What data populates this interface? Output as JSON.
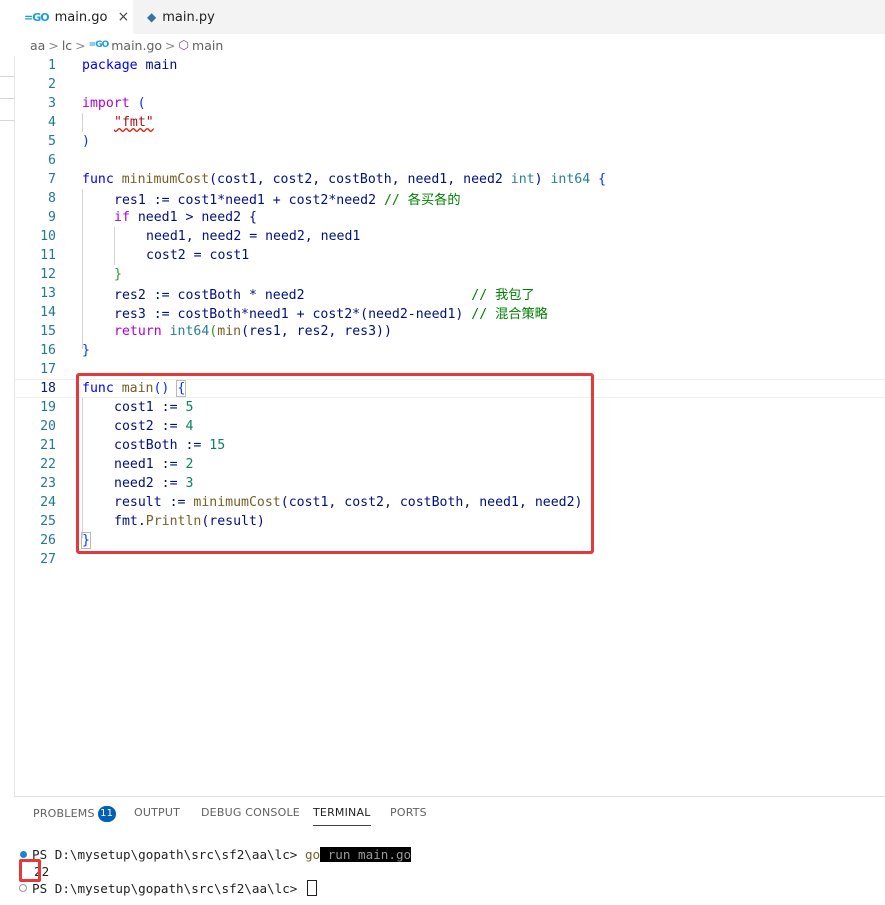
{
  "tabs": [
    {
      "name": "main.go",
      "close": "×",
      "active": true
    },
    {
      "name": "main.py",
      "active": false
    }
  ],
  "breadcrumb": {
    "parts": [
      "aa",
      "lc",
      "main.go",
      "main"
    ],
    "sep": ">"
  },
  "editor": {
    "line_numbers": [
      "1",
      "2",
      "3",
      "4",
      "5",
      "6",
      "7",
      "8",
      "9",
      "10",
      "11",
      "12",
      "13",
      "14",
      "15",
      "16",
      "17",
      "18",
      "19",
      "20",
      "21",
      "22",
      "23",
      "24",
      "25",
      "26",
      "27"
    ],
    "code": {
      "l1_kw": "package",
      "l1_rest": " main",
      "l3_kw": "import",
      "l3_rest": " (",
      "l4_str": "\"fmt\"",
      "l5": ")",
      "l7_kw": "func",
      "l7_fn": "minimumCost",
      "l7_a": "(cost1, cost2, costBoth, need1, need2 ",
      "l7_t1": "int",
      "l7_b": ") ",
      "l7_t2": "int64",
      "l7_c": " {",
      "l8_code": "res1 := cost1*need1 + cost2*need2 ",
      "l8_cm": "// 各买各的",
      "l9_kw": "if",
      "l9_rest": " need1 > need2 {",
      "l10": "need1, need2 = need2, need1",
      "l11": "cost2 = cost1",
      "l12": "}",
      "l13_code": "res2 := costBoth * need2                     ",
      "l13_cm": "// 我包了",
      "l14_code": "res3 := costBoth*need1 + cost2*(need2-need1) ",
      "l14_cm": "// 混合策略",
      "l15_kw": "return",
      "l15_t": "int64",
      "l15_a": "(",
      "l15_fn": "min",
      "l15_b": "(res1, res2, res3))",
      "l16": "}",
      "l18_kw": "func",
      "l18_fn": "main",
      "l18_a": "() ",
      "l18_b": "{",
      "l19_a": "cost1 := ",
      "l19_n": "5",
      "l20_a": "cost2 := ",
      "l20_n": "4",
      "l21_a": "costBoth := ",
      "l21_n": "15",
      "l22_a": "need1 := ",
      "l22_n": "2",
      "l23_a": "need2 := ",
      "l23_n": "3",
      "l24_a": "result := ",
      "l24_fn": "minimumCost",
      "l24_b": "(cost1, cost2, costBoth, need1, need2)",
      "l25_a": "fmt.",
      "l25_fn": "Println",
      "l25_b": "(result)",
      "l26": "}"
    }
  },
  "panel": {
    "tabs": [
      "PROBLEMS",
      "OUTPUT",
      "DEBUG CONSOLE",
      "TERMINAL",
      "PORTS"
    ],
    "problems_count": "11",
    "active_tab": "TERMINAL"
  },
  "terminal": {
    "prompt1": "PS D:\\mysetup\\gopath\\src\\sf2\\aa\\lc> ",
    "cmd_go": "go",
    "cmd_rest": " run main.go",
    "output": "22",
    "prompt2": "PS D:\\mysetup\\gopath\\src\\sf2\\aa\\lc> "
  },
  "colors": {
    "accent_red": "#e5383b",
    "badge_blue": "#005fb8",
    "go_blue": "#1a9ee0"
  }
}
